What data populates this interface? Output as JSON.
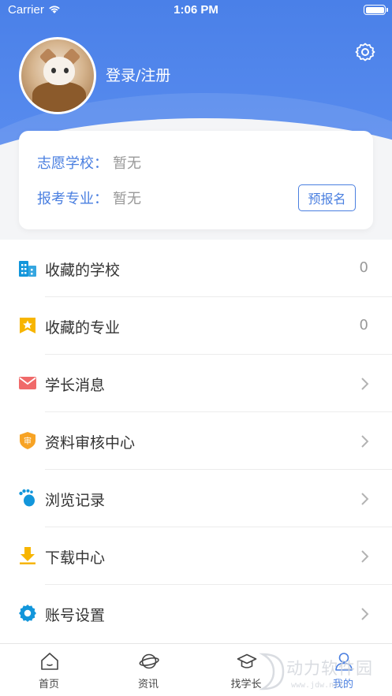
{
  "status_bar": {
    "carrier": "Carrier",
    "time": "1:06 PM"
  },
  "profile": {
    "login_label": "登录/注册"
  },
  "info_card": {
    "school_label": "志愿学校：",
    "school_value": "暂无",
    "major_label": "报考专业：",
    "major_value": "暂无",
    "prereg_button": "预报名"
  },
  "menu": {
    "items": [
      {
        "label": "收藏的学校",
        "count": "0",
        "icon": "building-icon"
      },
      {
        "label": "收藏的专业",
        "count": "0",
        "icon": "star-bookmark-icon"
      },
      {
        "label": "学长消息",
        "icon": "envelope-icon"
      },
      {
        "label": "资料审核中心",
        "icon": "review-badge-icon"
      },
      {
        "label": "浏览记录",
        "icon": "footprint-icon"
      },
      {
        "label": "下载中心",
        "icon": "download-icon"
      },
      {
        "label": "账号设置",
        "icon": "gear-icon"
      }
    ]
  },
  "tabbar": {
    "tabs": [
      {
        "label": "首页",
        "icon": "home-icon"
      },
      {
        "label": "资讯",
        "icon": "planet-icon"
      },
      {
        "label": "找学长",
        "icon": "graduation-cap-icon"
      },
      {
        "label": "我的",
        "icon": "user-icon"
      }
    ],
    "active_index": 3
  },
  "watermark": {
    "text": "动力软件园",
    "url": "www.jdw.net"
  },
  "colors": {
    "accent": "#4a7fe0",
    "header_blue": "#4a80e8",
    "text_primary": "#333333",
    "text_muted": "#999999",
    "icon_blue": "#1296db",
    "icon_yellow": "#f7b500",
    "icon_red": "#f06a6a",
    "icon_orange": "#f7a325"
  }
}
